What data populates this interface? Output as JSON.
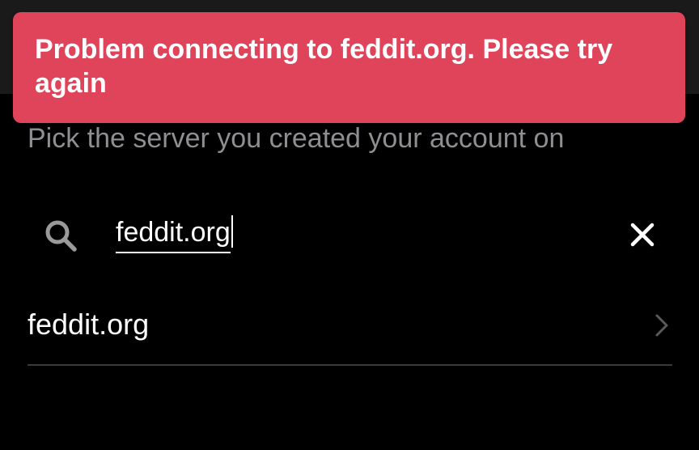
{
  "toast": {
    "message": "Problem connecting to feddit.org. Please try again",
    "background": "#e0445a"
  },
  "subtitle": "Pick the server you created your account on",
  "search": {
    "value": "feddit.org",
    "icon": "search-icon",
    "clear_icon": "close-icon"
  },
  "results": [
    {
      "label": "feddit.org",
      "icon": "chevron-right-icon"
    }
  ]
}
